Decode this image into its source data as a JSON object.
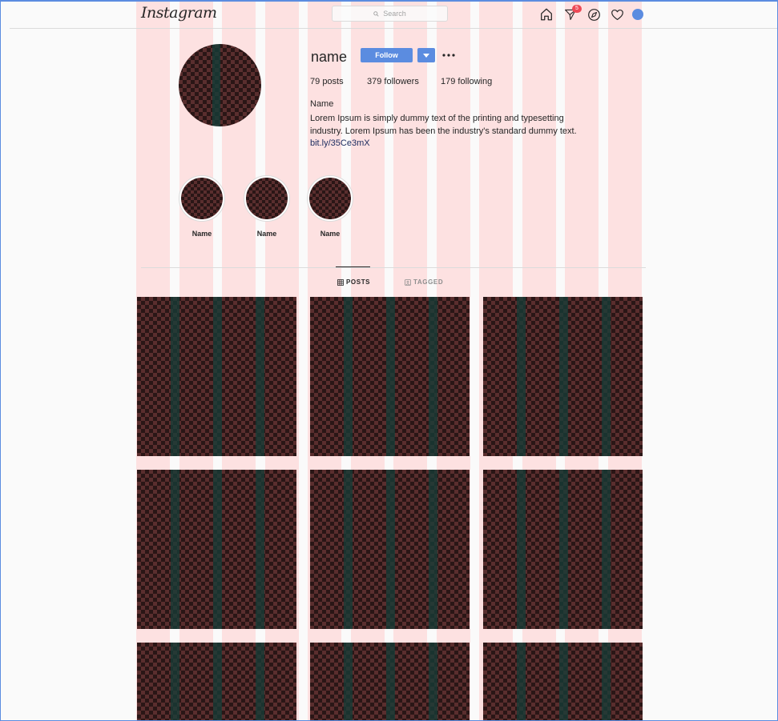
{
  "header": {
    "logo": "Instagram",
    "search_placeholder": "Search",
    "notification_count": "5",
    "icons": [
      "home-icon",
      "direct-icon",
      "explore-icon",
      "heart-icon",
      "profile-avatar"
    ]
  },
  "profile": {
    "username": "name",
    "follow_label": "Follow",
    "stats": {
      "posts_count": "79",
      "posts_label": "posts",
      "followers_count": "379",
      "followers_label": "followers",
      "following_count": "179",
      "following_label": "following"
    },
    "bio_name": "Name",
    "bio_text": "Lorem Ipsum is simply dummy text of the printing and typesetting industry. Lorem Ipsum has been the industry's standard dummy text.",
    "bio_link": "bit.ly/35Ce3mX"
  },
  "highlights": [
    {
      "label": "Name"
    },
    {
      "label": "Name"
    },
    {
      "label": "Name"
    }
  ],
  "tabs": [
    {
      "label": "POSTS",
      "active": true,
      "icon": "grid-icon"
    },
    {
      "label": "TAGGED",
      "active": false,
      "icon": "tag-icon"
    }
  ],
  "colors": {
    "accent": "#5b8ce0",
    "badge": "#ed4956",
    "grid_overlay": "#fde1e1"
  }
}
